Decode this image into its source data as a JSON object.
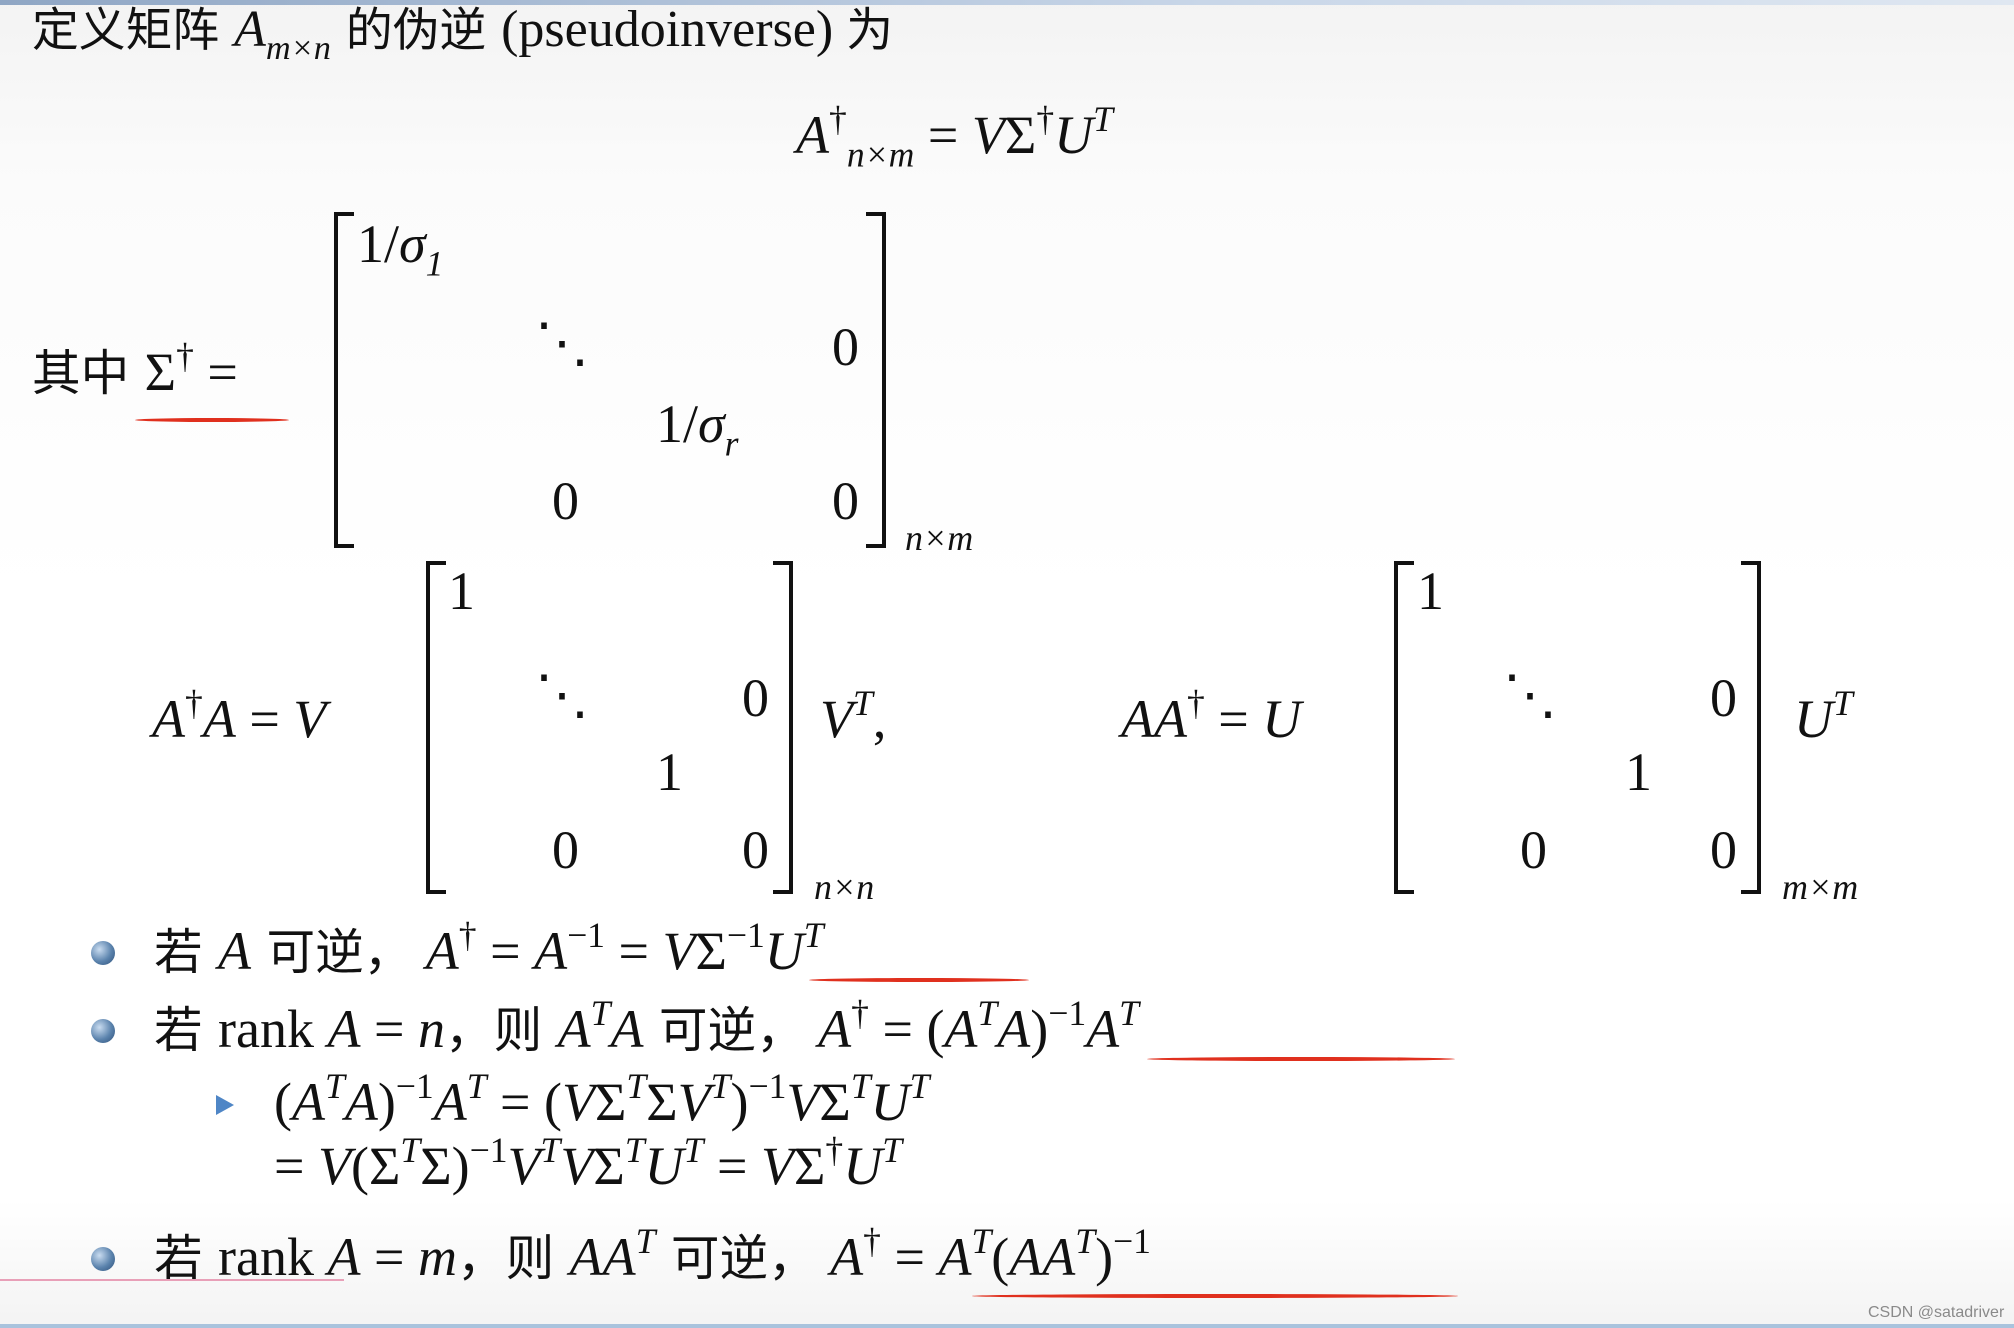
{
  "header": [
    {
      "t": "定义矩阵 ",
      "c": true
    },
    {
      "t": "A",
      "i": true
    },
    {
      "t": "m×n",
      "sub": true
    },
    {
      "t": " 的伪逆 ",
      "c": true
    },
    {
      "t": "(pseudoinverse) "
    },
    {
      "t": "为",
      "c": true
    }
  ],
  "definition": [
    {
      "t": "A",
      "i": true
    },
    {
      "t": "†",
      "sup": true
    },
    {
      "t": "n×m",
      "sub": true
    },
    {
      "t": " = "
    },
    {
      "t": "V",
      "i": true
    },
    {
      "t": "Σ"
    },
    {
      "t": "†",
      "sup": true
    },
    {
      "t": "U",
      "i": true
    },
    {
      "t": "T",
      "sup": true,
      "i": true
    }
  ],
  "sigma_label": [
    {
      "t": "其中 ",
      "c": true
    },
    {
      "t": "Σ"
    },
    {
      "t": "†",
      "sup": true
    },
    {
      "t": " ="
    }
  ],
  "sigma_matrix": {
    "e11": [
      {
        "t": "1/"
      },
      {
        "t": "σ",
        "i": true
      },
      {
        "t": "1",
        "sub": true
      }
    ],
    "dots": "⋱",
    "zero_upper": "0",
    "err": [
      {
        "t": "1/"
      },
      {
        "t": "σ",
        "i": true
      },
      {
        "t": "r",
        "sub": true
      }
    ],
    "zero_bl": "0",
    "zero_br": "0",
    "size": "n×m"
  },
  "left_product": {
    "lhs": [
      {
        "t": "A",
        "i": true
      },
      {
        "t": "†",
        "sup": true
      },
      {
        "t": "A",
        "i": true
      },
      {
        "t": " = "
      },
      {
        "t": "V",
        "i": true
      }
    ],
    "e11": "1",
    "dots": "⋱",
    "zero_upper": "0",
    "enn": "1",
    "zero_bl": "0",
    "zero_br": "0",
    "rhs": [
      {
        "t": "V",
        "i": true
      },
      {
        "t": "T",
        "sup": true,
        "i": true
      },
      {
        "t": ","
      }
    ],
    "size": "n×n"
  },
  "right_product": {
    "lhs": [
      {
        "t": "AA",
        "i": true
      },
      {
        "t": "†",
        "sup": true
      },
      {
        "t": " = "
      },
      {
        "t": "U",
        "i": true
      }
    ],
    "e11": "1",
    "dots": "⋱",
    "zero_upper": "0",
    "emm": "1",
    "zero_bl": "0",
    "zero_br": "0",
    "rhs": [
      {
        "t": "U",
        "i": true
      },
      {
        "t": "T",
        "sup": true,
        "i": true
      }
    ],
    "size": "m×m"
  },
  "bullets": {
    "invertible": [
      {
        "t": "若 ",
        "c": true
      },
      {
        "t": "A",
        "i": true
      },
      {
        "t": " 可逆，",
        "c": true
      },
      {
        "t": " A",
        "i": true
      },
      {
        "t": "†",
        "sup": true
      },
      {
        "t": " = "
      },
      {
        "t": "A",
        "i": true
      },
      {
        "t": "−1",
        "sup": true
      },
      {
        "t": " = "
      },
      {
        "t": "V",
        "i": true
      },
      {
        "t": "Σ"
      },
      {
        "t": "−1",
        "sup": true
      },
      {
        "t": "U",
        "i": true
      },
      {
        "t": "T",
        "sup": true,
        "i": true
      }
    ],
    "rank_n": [
      {
        "t": "若 ",
        "c": true
      },
      {
        "t": "rank "
      },
      {
        "t": "A",
        "i": true
      },
      {
        "t": " = "
      },
      {
        "t": "n",
        "i": true
      },
      {
        "t": "，则 ",
        "c": true
      },
      {
        "t": "A",
        "i": true
      },
      {
        "t": "T",
        "sup": true,
        "i": true
      },
      {
        "t": "A",
        "i": true
      },
      {
        "t": " 可逆，",
        "c": true
      },
      {
        "t": " A",
        "i": true
      },
      {
        "t": "†",
        "sup": true
      },
      {
        "t": " = ("
      },
      {
        "t": "A",
        "i": true
      },
      {
        "t": "T",
        "sup": true,
        "i": true
      },
      {
        "t": "A",
        "i": true
      },
      {
        "t": ")"
      },
      {
        "t": "−1",
        "sup": true
      },
      {
        "t": "A",
        "i": true
      },
      {
        "t": "T",
        "sup": true,
        "i": true
      }
    ],
    "derivation_line1": [
      {
        "t": "("
      },
      {
        "t": "A",
        "i": true
      },
      {
        "t": "T",
        "sup": true,
        "i": true
      },
      {
        "t": "A",
        "i": true
      },
      {
        "t": ")"
      },
      {
        "t": "−1",
        "sup": true
      },
      {
        "t": "A",
        "i": true
      },
      {
        "t": "T",
        "sup": true,
        "i": true
      },
      {
        "t": " = ("
      },
      {
        "t": "V",
        "i": true
      },
      {
        "t": "Σ"
      },
      {
        "t": "T",
        "sup": true,
        "i": true
      },
      {
        "t": "Σ"
      },
      {
        "t": "V",
        "i": true
      },
      {
        "t": "T",
        "sup": true,
        "i": true
      },
      {
        "t": ")"
      },
      {
        "t": "−1",
        "sup": true
      },
      {
        "t": "V",
        "i": true
      },
      {
        "t": "Σ"
      },
      {
        "t": "T",
        "sup": true,
        "i": true
      },
      {
        "t": "U",
        "i": true
      },
      {
        "t": "T",
        "sup": true,
        "i": true
      }
    ],
    "derivation_line2": [
      {
        "t": "= "
      },
      {
        "t": "V",
        "i": true
      },
      {
        "t": "(Σ"
      },
      {
        "t": "T",
        "sup": true,
        "i": true
      },
      {
        "t": "Σ)"
      },
      {
        "t": "−1",
        "sup": true
      },
      {
        "t": "V",
        "i": true
      },
      {
        "t": "T",
        "sup": true,
        "i": true
      },
      {
        "t": "V",
        "i": true
      },
      {
        "t": "Σ"
      },
      {
        "t": "T",
        "sup": true,
        "i": true
      },
      {
        "t": "U",
        "i": true
      },
      {
        "t": "T",
        "sup": true,
        "i": true
      },
      {
        "t": " = "
      },
      {
        "t": "V",
        "i": true
      },
      {
        "t": "Σ"
      },
      {
        "t": "†",
        "sup": true
      },
      {
        "t": "U",
        "i": true
      },
      {
        "t": "T",
        "sup": true,
        "i": true
      }
    ],
    "rank_m": [
      {
        "t": "若 ",
        "c": true
      },
      {
        "t": "rank "
      },
      {
        "t": "A",
        "i": true
      },
      {
        "t": " = "
      },
      {
        "t": "m",
        "i": true
      },
      {
        "t": "，则 ",
        "c": true
      },
      {
        "t": "AA",
        "i": true
      },
      {
        "t": "T",
        "sup": true,
        "i": true
      },
      {
        "t": " 可逆，",
        "c": true
      },
      {
        "t": " A",
        "i": true
      },
      {
        "t": "†",
        "sup": true
      },
      {
        "t": " = "
      },
      {
        "t": "A",
        "i": true
      },
      {
        "t": "T",
        "sup": true,
        "i": true
      },
      {
        "t": "("
      },
      {
        "t": "AA",
        "i": true
      },
      {
        "t": "T",
        "sup": true,
        "i": true
      },
      {
        "t": ")"
      },
      {
        "t": "−1",
        "sup": true
      }
    ]
  },
  "annotation_color": "#e0301e",
  "bullet_color": "#5b83ad",
  "watermark": "CSDN @satadriver"
}
